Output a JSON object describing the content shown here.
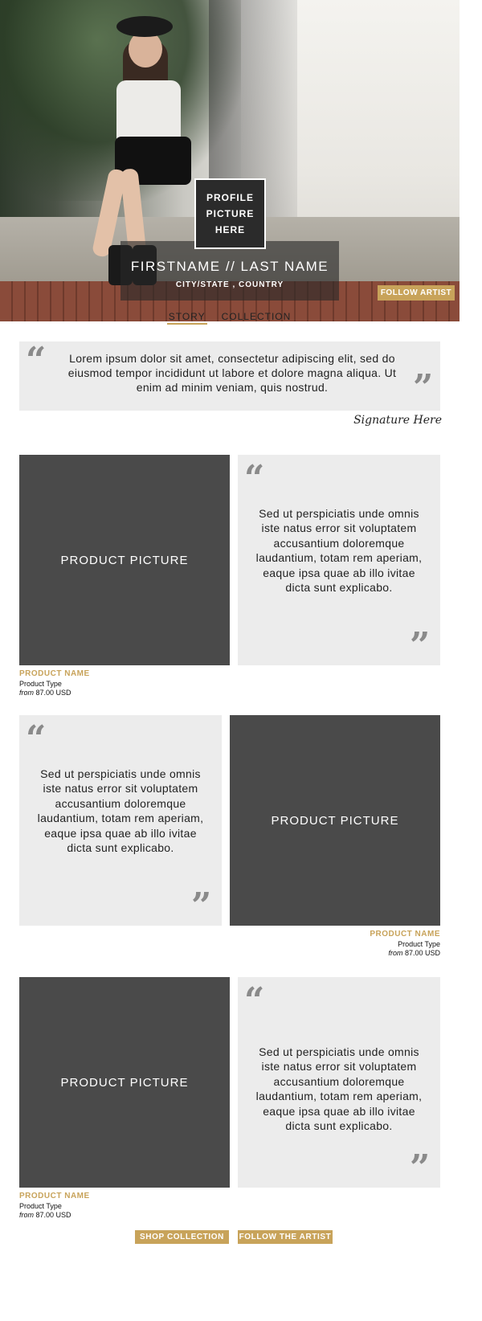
{
  "hero": {
    "profile_lines": [
      "PROFILE",
      "PICTURE",
      "HERE"
    ],
    "name": "FIRSTNAME // LAST NAME",
    "location": "CITY/STATE , COUNTRY",
    "follow_label": "FOLLOW ARTIST"
  },
  "tabs": [
    {
      "label": "STORY",
      "active": true
    },
    {
      "label": "COLLECTION",
      "active": false
    }
  ],
  "intro_quote": {
    "text": "Lorem ipsum dolor sit amet, consectetur adipiscing elit, sed do eiusmod tempor incididunt ut labore et dolore magna aliqua. Ut enim ad minim veniam, quis nostrud.",
    "signature": "Signature Here"
  },
  "blocks": [
    {
      "picture_label": "PRODUCT PICTURE",
      "quote": "Sed ut perspiciatis unde omnis iste natus error sit voluptatem accusantium doloremque laudantium, totam rem aperiam, eaque ipsa quae ab illo ivitae dicta sunt explicabo.",
      "product_name": "PRODUCT NAME",
      "product_type": "Product Type",
      "price_prefix": "from",
      "price": "87.00 USD"
    },
    {
      "picture_label": "PRODUCT PICTURE",
      "quote": "Sed ut perspiciatis unde omnis iste natus error sit voluptatem accusantium doloremque laudantium, totam rem aperiam, eaque ipsa quae ab illo ivitae dicta sunt explicabo.",
      "product_name": "PRODUCT NAME",
      "product_type": "Product Type",
      "price_prefix": "from",
      "price": "87.00 USD"
    },
    {
      "picture_label": "PRODUCT PICTURE",
      "quote": "Sed ut perspiciatis unde omnis iste natus error sit voluptatem accusantium doloremque laudantium, totam rem aperiam, eaque ipsa quae ab illo ivitae dicta sunt explicabo.",
      "product_name": "PRODUCT NAME",
      "product_type": "Product Type",
      "price_prefix": "from",
      "price": "87.00 USD"
    }
  ],
  "buttons": {
    "shop_collection": "SHOP COLLECTION",
    "follow_the_artist": "FOLLOW THE ARTIST"
  },
  "glyphs": {
    "quote_open": "“",
    "quote_close": "”"
  },
  "colors": {
    "accent": "#c8a35a",
    "picture_bg": "#4a4a4a",
    "quote_bg": "#ececec"
  }
}
